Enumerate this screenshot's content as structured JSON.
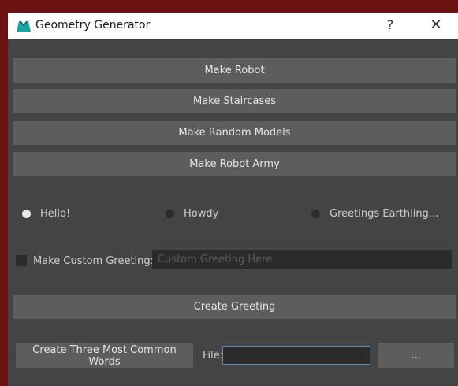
{
  "window": {
    "title": "Geometry Generator",
    "help_label": "?",
    "close_label": "✕",
    "icon": "maya-app-icon"
  },
  "buttons": {
    "make_robot": "Make Robot",
    "make_staircases": "Make Staircases",
    "make_random_models": "Make Random Models",
    "make_robot_army": "Make Robot Army",
    "create_greeting": "Create Greeting",
    "create_words": "Create Three Most Common Words",
    "browse": "..."
  },
  "greetings": {
    "options": [
      {
        "label": "Hello!",
        "checked": true
      },
      {
        "label": "Howdy",
        "checked": false
      },
      {
        "label": "Greetings Earthling...",
        "checked": false
      }
    ]
  },
  "custom_greeting": {
    "checkbox_label": "Make Custom Greeting:",
    "checked": false,
    "placeholder": "Custom Greeting Here",
    "value": ""
  },
  "file": {
    "label": "File:",
    "value": ""
  },
  "colors": {
    "background": "#444444",
    "button": "#5d5d5d",
    "field": "#2b2b2b",
    "focus_border": "#5a8ab8",
    "outer_frame": "#6b1212"
  }
}
